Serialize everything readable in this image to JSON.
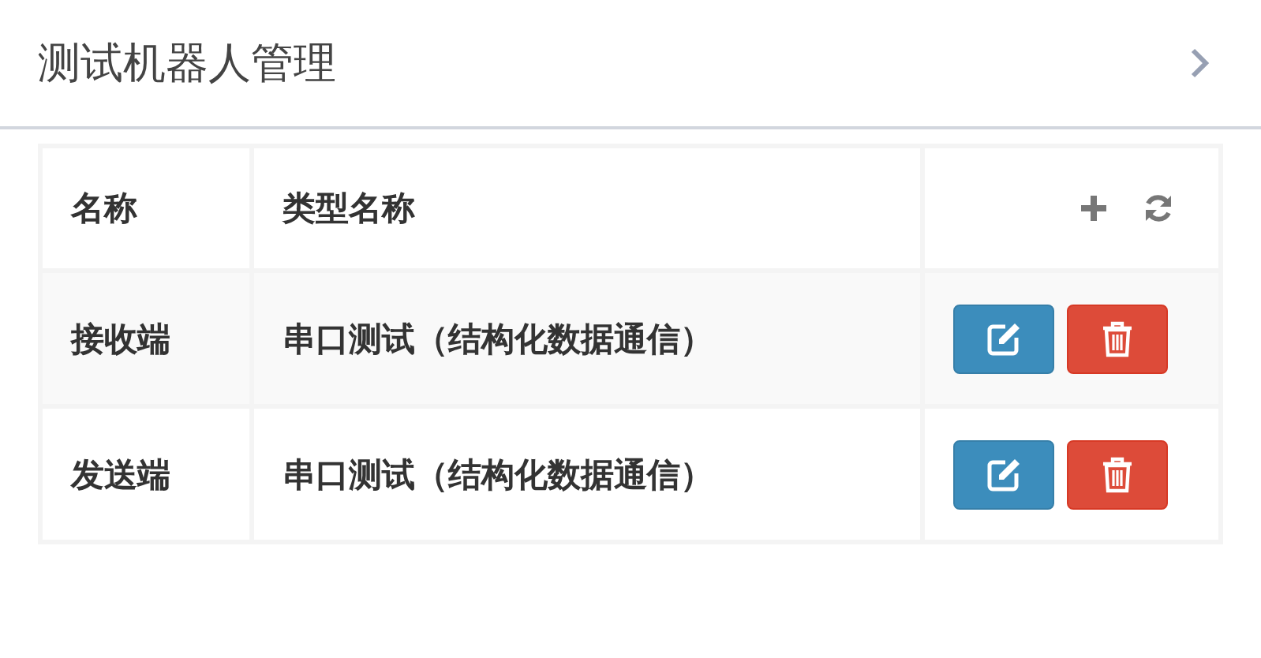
{
  "panel": {
    "title": "测试机器人管理"
  },
  "table": {
    "columns": [
      "名称",
      "类型名称"
    ],
    "rows": [
      {
        "name": "接收端",
        "type": "串口测试（结构化数据通信）"
      },
      {
        "name": "发送端",
        "type": "串口测试（结构化数据通信）"
      }
    ]
  }
}
